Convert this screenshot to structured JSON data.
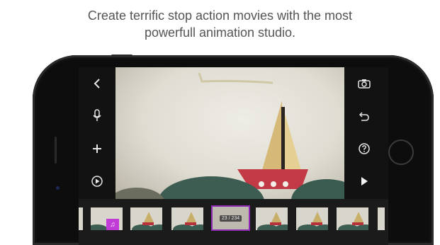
{
  "headline": {
    "line1": "Create terrific stop action movies with the most",
    "line2": "powerfull animation studio."
  },
  "toolbar_left": {
    "back_icon": "chevron-left",
    "microphone_icon": "microphone",
    "add_icon": "plus",
    "play_circle_icon": "play-circle"
  },
  "toolbar_right": {
    "camera_icon": "camera",
    "undo_icon": "undo-arrow",
    "help_icon": "question-circle",
    "play_icon": "play"
  },
  "timeline": {
    "frame_counter": "23 / 234",
    "music_badge_icon": "music-note"
  },
  "colors": {
    "accent": "#8f2bb8",
    "music_badge": "#c13bd6",
    "boat_hull": "#b6333b",
    "sail": "#c9b06a",
    "hills": "#3d5d52"
  }
}
